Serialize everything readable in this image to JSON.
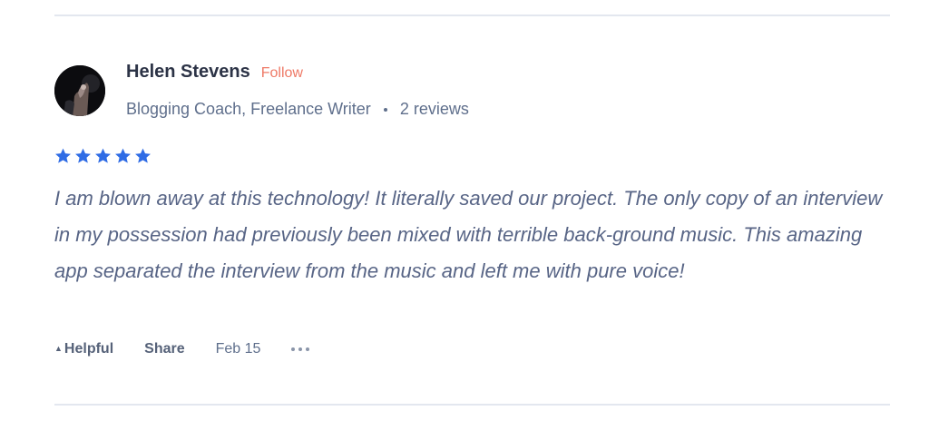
{
  "reviewer": {
    "name": "Helen Stevens",
    "follow_label": "Follow",
    "title": "Blogging Coach, Freelance Writer",
    "review_count": "2 reviews",
    "avatar_icon": "avatar-photo"
  },
  "rating": {
    "stars": 5,
    "max": 5,
    "color": "#2f6ce5"
  },
  "review": {
    "text": "I am blown away at this technology! It literally saved our project. The only copy of an interview in my possession had previously been mixed with terrible back-ground music. This amazing app separated the interview from the music and left me with pure voice!"
  },
  "actions": {
    "helpful_label": "Helpful",
    "helpful_icon": "triangle-up-icon",
    "share_label": "Share",
    "date": "Feb 15",
    "more_icon": "more-dots-icon"
  },
  "colors": {
    "follow": "#ee7966",
    "text": "#586586",
    "divider": "#e3e7ef"
  }
}
